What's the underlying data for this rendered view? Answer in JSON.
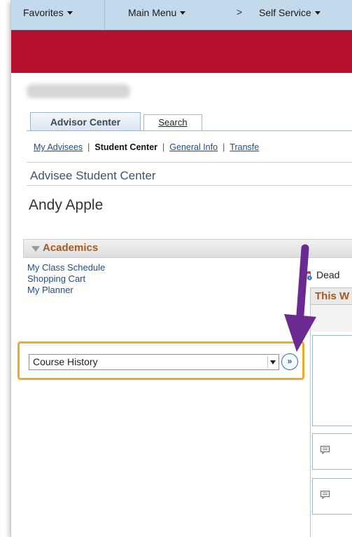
{
  "top_menu": {
    "favorites": "Favorites",
    "main_menu": "Main Menu",
    "breadcrumb_sep": ">",
    "self_service": "Self Service"
  },
  "tabs": {
    "advisor_center": "Advisor Center",
    "search": "Search"
  },
  "subnav": {
    "items": [
      "My Advisees",
      "Student Center",
      "General Info",
      "Transfe"
    ],
    "separator": "|"
  },
  "page_title": "Advisee Student Center",
  "student_name": "Andy Apple",
  "academics": {
    "title": "Academics",
    "links": [
      "My Class Schedule",
      "Shopping Cart",
      "My Planner"
    ],
    "dropdown": {
      "selected": "Course History"
    }
  },
  "right_pane": {
    "deadlines": "Dead",
    "table_title": "This W"
  },
  "colors": {
    "brand_red": "#b5102c",
    "menu_blue": "#c3d9ec",
    "section_orange": "#a8591b",
    "highlight": "#f0a92a",
    "arrow_purple": "#6a2a8f"
  }
}
